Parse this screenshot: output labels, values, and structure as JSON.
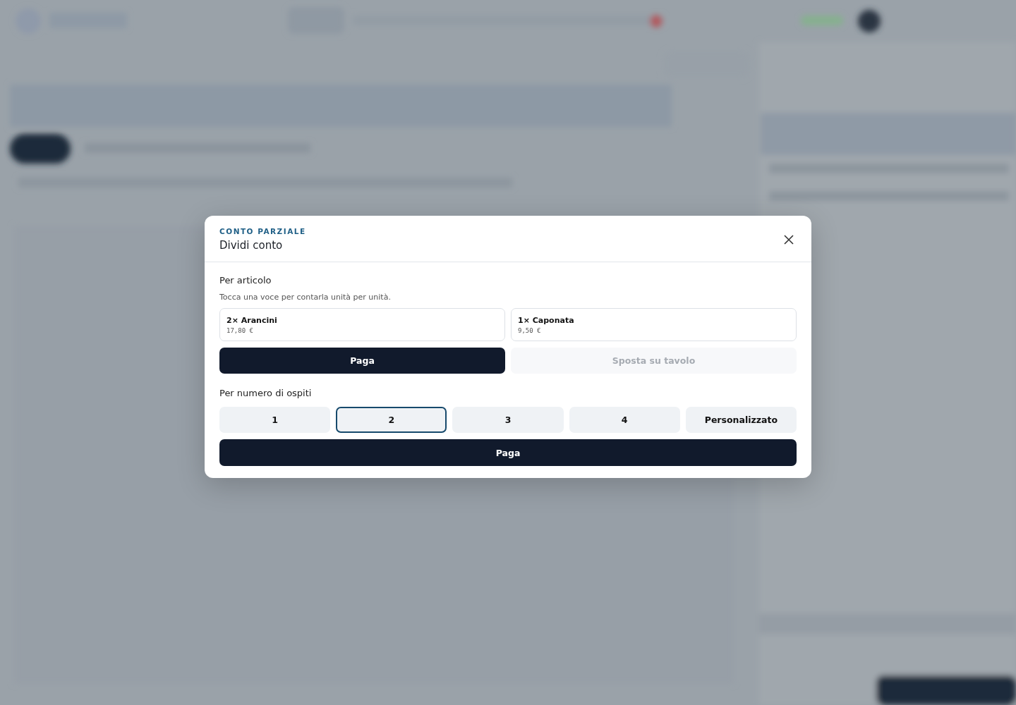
{
  "dialog": {
    "eyebrow": "CONTO PARZIALE",
    "title": "Dividi conto",
    "by_item": {
      "label": "Per articolo",
      "hint": "Tocca una voce per contarla unità per unità.",
      "items": [
        {
          "name": "2× Arancini",
          "price": "17,80 €"
        },
        {
          "name": "1× Caponata",
          "price": "9,50 €"
        }
      ],
      "actions": [
        {
          "label": "Paga",
          "kind": "primary",
          "disabled": false
        },
        {
          "label": "Sposta su tavolo",
          "kind": "secondary",
          "disabled": true
        }
      ]
    },
    "by_guests": {
      "label": "Per numero di ospiti",
      "options": [
        {
          "label": "1",
          "selected": false
        },
        {
          "label": "2",
          "selected": true
        },
        {
          "label": "3",
          "selected": false
        },
        {
          "label": "4",
          "selected": false
        },
        {
          "label": "Personalizzato",
          "selected": false
        }
      ],
      "pay": {
        "label": "Paga"
      }
    }
  }
}
